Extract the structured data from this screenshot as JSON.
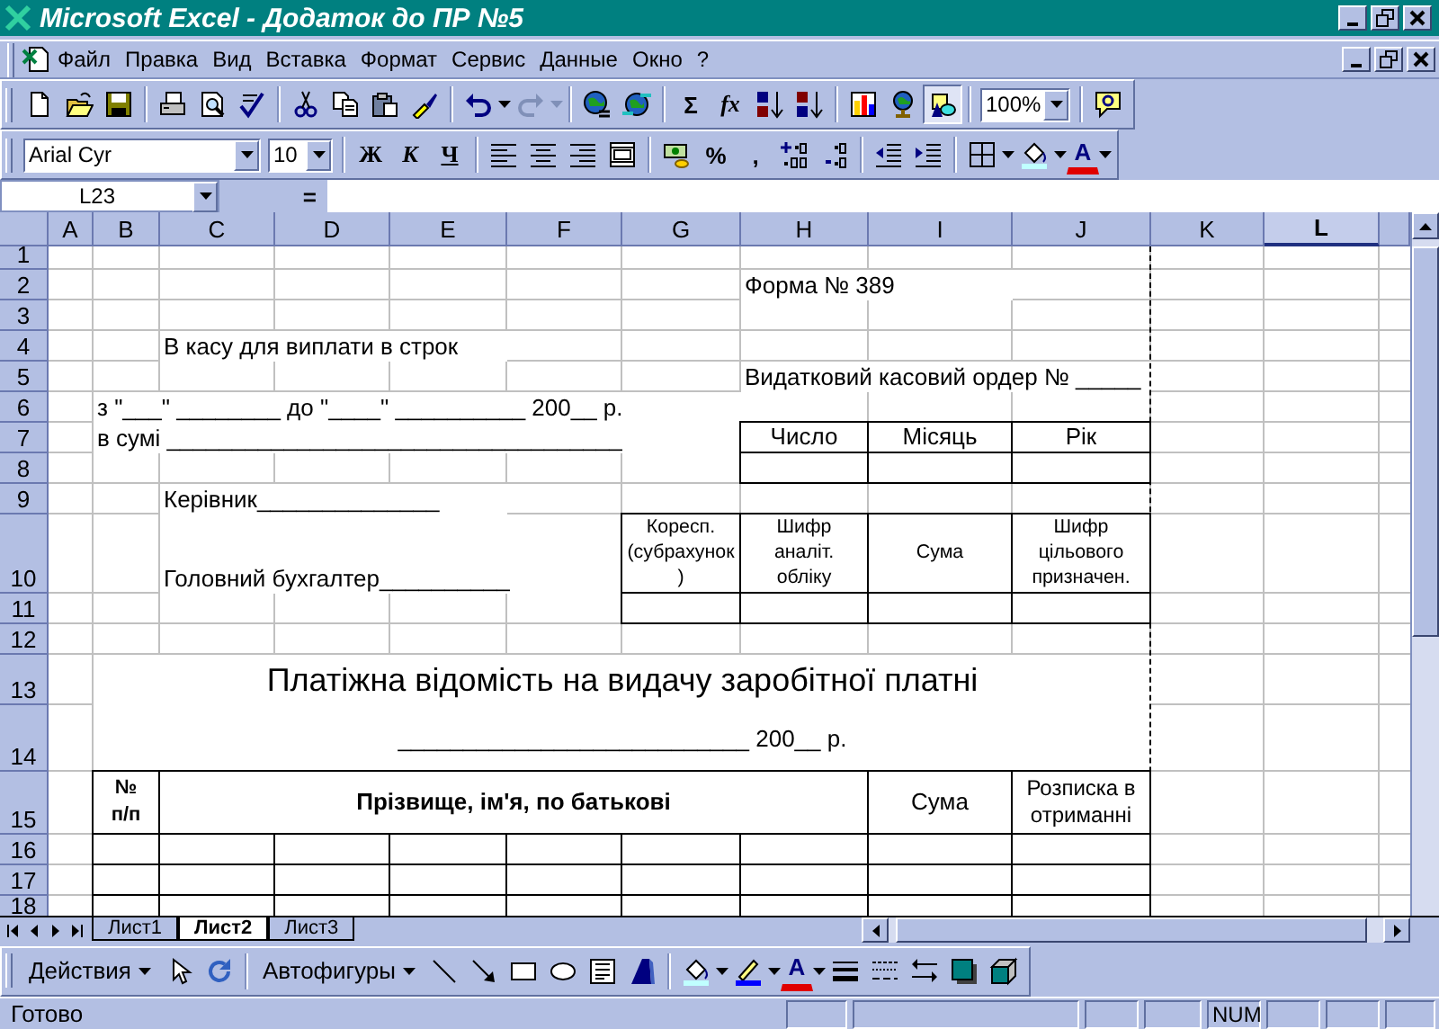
{
  "window": {
    "title": "Microsoft Excel - Додаток до ПР №5"
  },
  "menu": [
    "Файл",
    "Правка",
    "Вид",
    "Вставка",
    "Формат",
    "Сервис",
    "Данные",
    "Окно",
    "?"
  ],
  "standard_toolbar": {
    "autosum": "Σ",
    "function": "fx",
    "zoom": "100%",
    "drawing_pressed": true
  },
  "formatting_toolbar": {
    "font": "Arial Cyr",
    "size": "10",
    "style_buttons": [
      "Ж",
      "К",
      "Ч"
    ],
    "percent": "%",
    "comma": ",",
    "font_color": "A"
  },
  "formula_bar": {
    "name_box": "L23",
    "equals": "="
  },
  "sheet": {
    "columns": [
      {
        "label": "A",
        "selected": false
      },
      {
        "label": "B",
        "selected": false
      },
      {
        "label": "C",
        "selected": false
      },
      {
        "label": "D",
        "selected": false
      },
      {
        "label": "E",
        "selected": false
      },
      {
        "label": "F",
        "selected": false
      },
      {
        "label": "G",
        "selected": false
      },
      {
        "label": "H",
        "selected": false
      },
      {
        "label": "I",
        "selected": false
      },
      {
        "label": "J",
        "selected": false
      },
      {
        "label": "K",
        "selected": false
      },
      {
        "label": "L",
        "selected": true
      }
    ],
    "rows": [
      {
        "header": "1"
      },
      {
        "header": "2",
        "cells": [
          {
            "text": "Форма № 389"
          }
        ]
      },
      {
        "header": "3"
      },
      {
        "header": "4",
        "cells": [
          {
            "text": "В касу для виплати в строк"
          }
        ]
      },
      {
        "header": "5",
        "cells": [
          {
            "text": "Видатковий касовий ордер № _____"
          }
        ]
      },
      {
        "header": "6",
        "cells": [
          {
            "text": "з \"___\" ________ до \"____\" __________ 200__ р."
          }
        ]
      },
      {
        "header": "7",
        "cells": [
          {
            "text": "в сумі ___________________________________"
          },
          {
            "text": "Число"
          },
          {
            "text": "Місяць"
          },
          {
            "text": "Рік"
          }
        ]
      },
      {
        "header": "8"
      },
      {
        "header": "9",
        "cells": [
          {
            "text": "Керівник______________"
          }
        ]
      },
      {
        "header": "10",
        "cells": [
          {
            "text": "Головний бухгалтер__________"
          },
          {
            "text": "Коресп. (субрахунок)"
          },
          {
            "text": "Шифр аналіт. обліку"
          },
          {
            "text": "Сума"
          },
          {
            "text": "Шифр цільового призначен."
          }
        ]
      },
      {
        "header": "11"
      },
      {
        "header": "12"
      },
      {
        "header": "13",
        "cells": [
          {
            "text": "Платіжна відомість на видачу заробітної платні"
          }
        ]
      },
      {
        "header": "14",
        "cells": [
          {
            "text": "___________________________ 200__ р."
          }
        ]
      },
      {
        "header": "15",
        "cells": [
          {
            "text": "№ п/п"
          },
          {
            "text": "Прізвище, ім'я, по батькові"
          },
          {
            "text": "Сума"
          },
          {
            "text": "Розписка в отриманні"
          }
        ]
      },
      {
        "header": "16"
      },
      {
        "header": "17"
      },
      {
        "header": "18"
      }
    ]
  },
  "sheet_tabs": [
    {
      "label": "Лист1",
      "selected": false
    },
    {
      "label": "Лист2",
      "selected": true
    },
    {
      "label": "Лист3",
      "selected": false
    }
  ],
  "drawing_toolbar": {
    "actions": "Действия",
    "autoshapes": "Автофигуры",
    "font_color": "A"
  },
  "status_bar": {
    "text": "Готово",
    "num_lock": "NUM"
  }
}
